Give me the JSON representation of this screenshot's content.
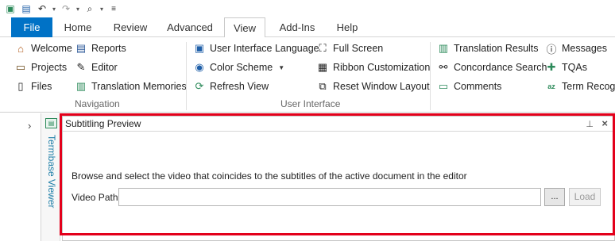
{
  "qat": {
    "icons": [
      "app-icon",
      "save-icon",
      "undo-icon",
      "redo-icon",
      "preview-icon",
      "customize-icon"
    ]
  },
  "tabs": [
    {
      "label": "File"
    },
    {
      "label": "Home"
    },
    {
      "label": "Review"
    },
    {
      "label": "Advanced"
    },
    {
      "label": "View"
    },
    {
      "label": "Add-Ins"
    },
    {
      "label": "Help"
    }
  ],
  "active_tab": "View",
  "ribbon": {
    "navigation": {
      "group_label": "Navigation",
      "items": [
        "Welcome",
        "Projects",
        "Files",
        "Reports",
        "Editor",
        "Translation Memories"
      ]
    },
    "user_interface": {
      "group_label": "User Interface",
      "items": [
        "User Interface Language",
        "Color Scheme",
        "Refresh View",
        "Full Screen",
        "Ribbon Customization",
        "Reset Window Layout"
      ]
    },
    "windows": {
      "items": [
        "Translation Results",
        "Concordance Search",
        "Comments",
        "Messages",
        "TQAs",
        "Term Recogn"
      ]
    }
  },
  "side": {
    "termbase_label": "Termbase Viewer"
  },
  "panel": {
    "title": "Subtitling Preview",
    "hint": "Browse and select the video that coincides to the subtitles of the active document in the editor",
    "video_path_label": "Video Path:",
    "video_path_value": "",
    "browse_label": "...",
    "load_label": "Load"
  },
  "colors": {
    "file_tab": "#0072c6",
    "highlight": "#e3001b",
    "accent_link": "#1f7fa8"
  }
}
